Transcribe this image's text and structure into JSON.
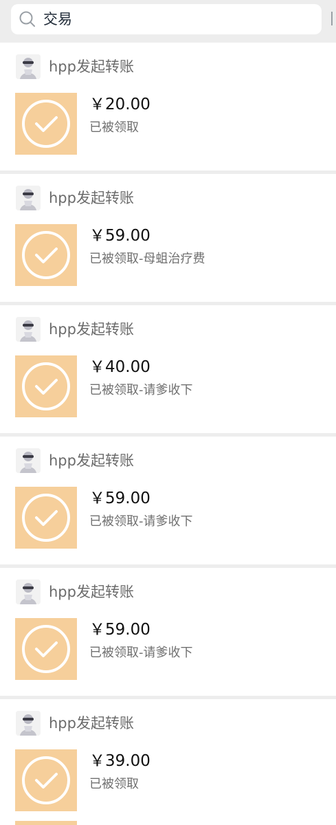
{
  "search": {
    "query": "交易",
    "icon": "search-icon"
  },
  "colors": {
    "background": "#ededed",
    "card": "#ffffff",
    "transfer_tile": "#f6cf9b",
    "amount": "#111111",
    "status": "#707070"
  },
  "records": [
    {
      "sender": "hpp发起转账",
      "amount": "￥20.00",
      "status": "已被领取"
    },
    {
      "sender": "hpp发起转账",
      "amount": "￥59.00",
      "status": "已被领取-母蛆治疗费"
    },
    {
      "sender": "hpp发起转账",
      "amount": "￥40.00",
      "status": "已被领取-请爹收下"
    },
    {
      "sender": "hpp发起转账",
      "amount": "￥59.00",
      "status": "已被领取-请爹收下"
    },
    {
      "sender": "hpp发起转账",
      "amount": "￥59.00",
      "status": "已被领取-请爹收下"
    },
    {
      "sender": "hpp发起转账",
      "amount": "￥39.00",
      "status": "已被领取"
    }
  ]
}
